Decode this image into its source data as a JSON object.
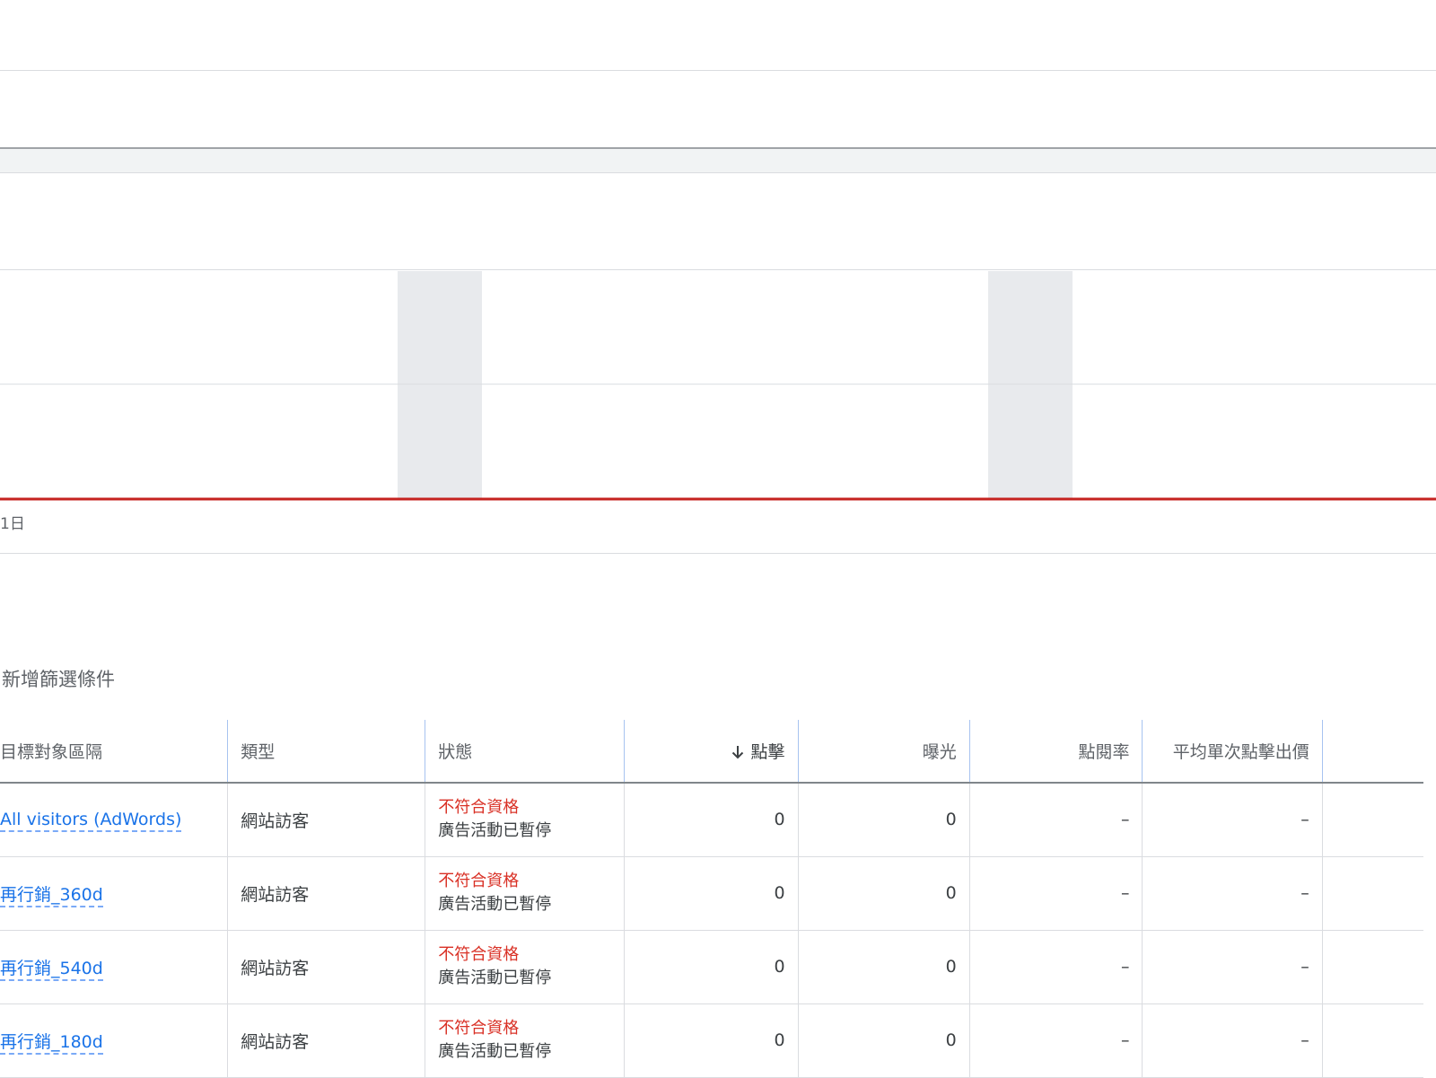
{
  "chart": {
    "x_label_first": "1日",
    "colors": {
      "series_line": "#c5221f",
      "weekend_band": "#e8eaed",
      "gridline": "#dadce0"
    }
  },
  "chart_data": {
    "type": "line",
    "x_tick_labels": [
      "1日"
    ],
    "series": [
      {
        "values": [
          0,
          0,
          0,
          0,
          0,
          0,
          0,
          0,
          0,
          0,
          0,
          0,
          0,
          0,
          0,
          0,
          0
        ]
      }
    ],
    "grid": true,
    "weekend_bands": [
      5,
      12
    ]
  },
  "filter": {
    "add_filter_label": "新增篩選條件"
  },
  "table": {
    "headers": {
      "segment": "目標對象區隔",
      "type": "類型",
      "status": "狀態",
      "clicks": "點擊",
      "impressions": "曝光",
      "ctr": "點閱率",
      "avg_cpc": "平均單次點擊出價"
    },
    "rows": [
      {
        "segment": "All visitors (AdWords)",
        "type": "網站訪客",
        "status": "不符合資格",
        "status_detail": "廣告活動已暫停",
        "clicks": "0",
        "impressions": "0",
        "ctr": "–",
        "avg_cpc": "–"
      },
      {
        "segment": "再行銷_360d",
        "type": "網站訪客",
        "status": "不符合資格",
        "status_detail": "廣告活動已暫停",
        "clicks": "0",
        "impressions": "0",
        "ctr": "–",
        "avg_cpc": "–"
      },
      {
        "segment": "再行銷_540d",
        "type": "網站訪客",
        "status": "不符合資格",
        "status_detail": "廣告活動已暫停",
        "clicks": "0",
        "impressions": "0",
        "ctr": "–",
        "avg_cpc": "–"
      },
      {
        "segment": "再行銷_180d",
        "type": "網站訪客",
        "status": "不符合資格",
        "status_detail": "廣告活動已暫停",
        "clicks": "0",
        "impressions": "0",
        "ctr": "–",
        "avg_cpc": "–"
      }
    ]
  }
}
